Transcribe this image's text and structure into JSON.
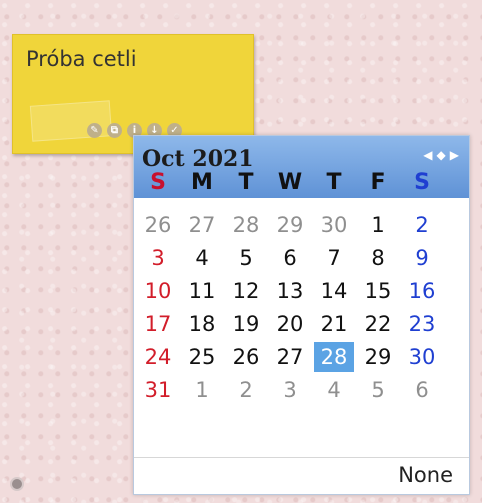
{
  "note": {
    "title": "Próba cetli",
    "icons": [
      "edit-icon",
      "copy-icon",
      "info-icon",
      "download-icon",
      "check-icon"
    ]
  },
  "calendar": {
    "title": "Oct 2021",
    "weekdays": [
      "S",
      "M",
      "T",
      "W",
      "T",
      "F",
      "S"
    ],
    "weeks": [
      [
        "26",
        "27",
        "28",
        "29",
        "30",
        "1",
        "2"
      ],
      [
        "3",
        "4",
        "5",
        "6",
        "7",
        "8",
        "9"
      ],
      [
        "10",
        "11",
        "12",
        "13",
        "14",
        "15",
        "16"
      ],
      [
        "17",
        "18",
        "19",
        "20",
        "21",
        "22",
        "23"
      ],
      [
        "24",
        "25",
        "26",
        "27",
        "28",
        "29",
        "30"
      ],
      [
        "31",
        "1",
        "2",
        "3",
        "4",
        "5",
        "6"
      ]
    ],
    "selected": "28",
    "footer_button": "None",
    "colors": {
      "header_top": "#8eb8ea",
      "header_bottom": "#5f92d6",
      "selected": "#5ba3e4",
      "sunday": "#d21d2a",
      "saturday": "#1f3fd1",
      "other_month": "#8f8f8f"
    }
  }
}
